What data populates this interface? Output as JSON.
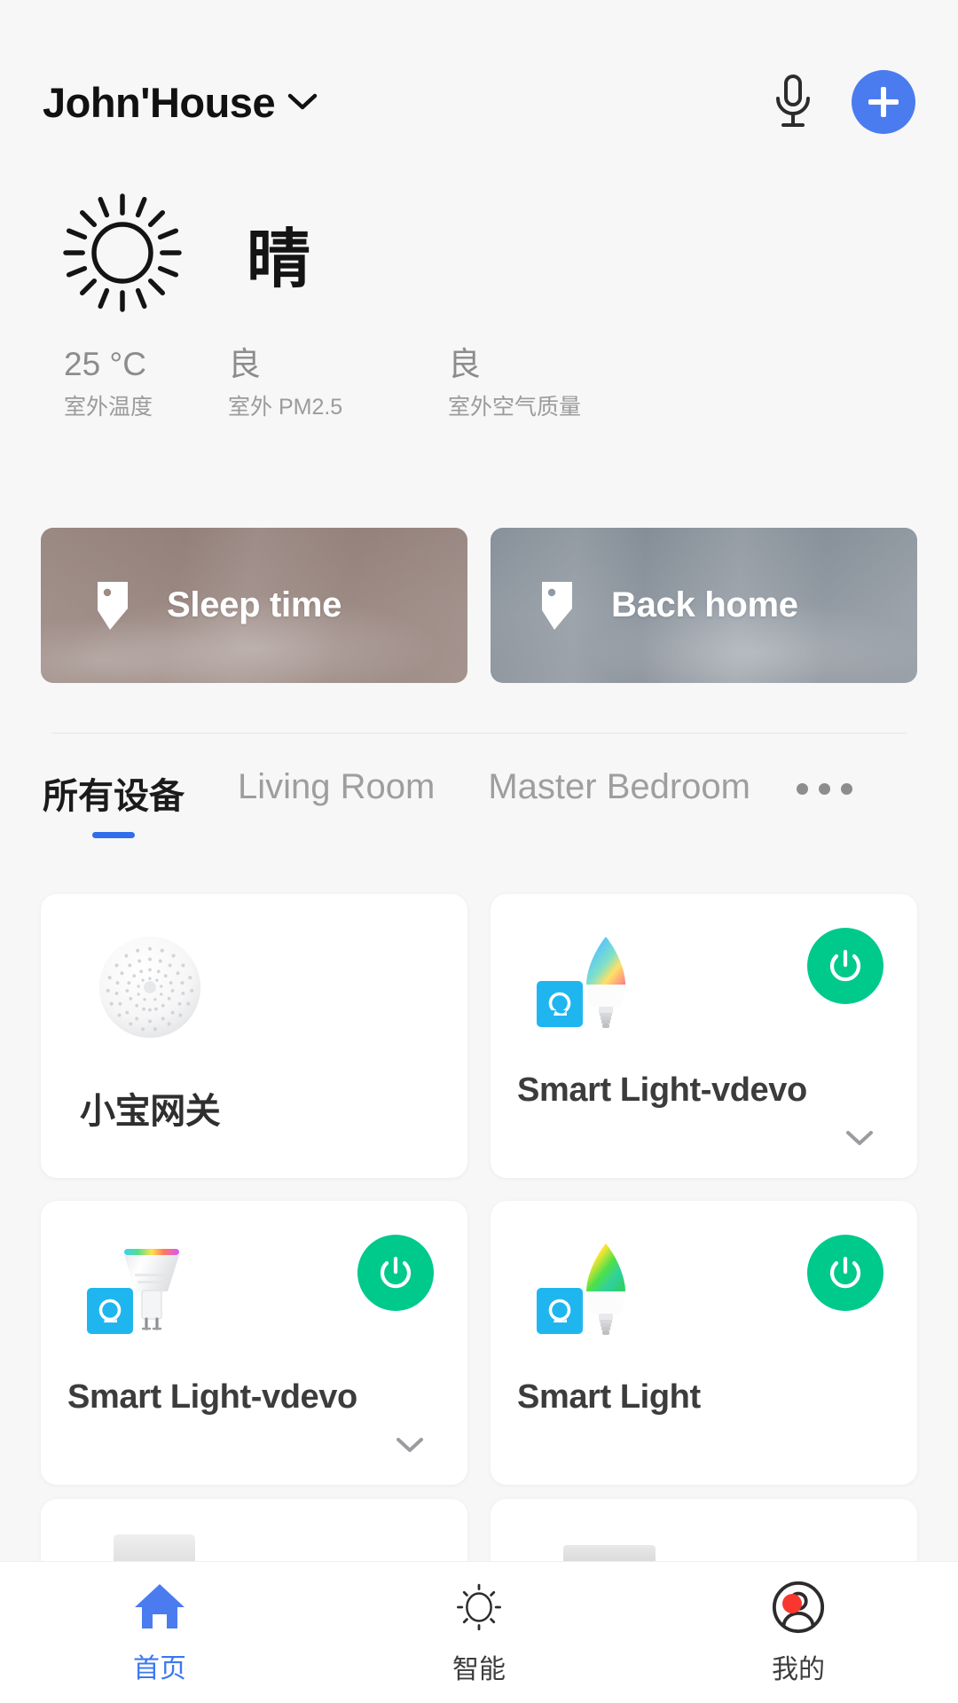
{
  "header": {
    "home_name": "John'House",
    "chevron_icon": "chevron-down-icon",
    "mic_icon": "microphone-icon",
    "add_icon": "plus-icon",
    "add_button_color": "#4a7cf0"
  },
  "weather": {
    "icon": "sun-icon",
    "condition": "晴",
    "stats": [
      {
        "value": "25 °C",
        "label": "室外温度"
      },
      {
        "value": "良",
        "label": "室外 PM2.5"
      },
      {
        "value": "良",
        "label": "室外空气质量"
      }
    ]
  },
  "scenes": [
    {
      "label": "Sleep time",
      "icon": "tag-icon",
      "color": "#9d8b84"
    },
    {
      "label": "Back home",
      "icon": "tag-icon",
      "color": "#909aa2"
    }
  ],
  "tabs": {
    "items": [
      {
        "label": "所有设备",
        "active": true
      },
      {
        "label": "Living Room",
        "active": false
      },
      {
        "label": "Master Bedroom",
        "active": false
      }
    ],
    "more_icon": "more-horizontal-icon",
    "active_color": "#2f6dea"
  },
  "devices": [
    {
      "name": "小宝网关",
      "icon": "gateway-icon",
      "has_power": false,
      "has_expand": false,
      "badge": null
    },
    {
      "name": "Smart Light-vdevo",
      "icon": "candle-bulb-icon",
      "has_power": true,
      "power_state": "on",
      "has_expand": true,
      "badge": "alexa-badge"
    },
    {
      "name": "Smart Light-vdevo",
      "icon": "spotlight-bulb-icon",
      "has_power": true,
      "power_state": "on",
      "has_expand": true,
      "badge": "alexa-badge"
    },
    {
      "name": "Smart Light",
      "icon": "candle-bulb-icon",
      "has_power": true,
      "power_state": "on",
      "has_expand": false,
      "badge": "alexa-badge"
    }
  ],
  "power_button_color": "#00c98c",
  "bottom_nav": [
    {
      "label": "首页",
      "icon": "home-icon",
      "active": true,
      "badge": false
    },
    {
      "label": "智能",
      "icon": "brightness-sun-icon",
      "active": false,
      "badge": false
    },
    {
      "label": "我的",
      "icon": "user-avatar-icon",
      "active": false,
      "badge": true
    }
  ]
}
